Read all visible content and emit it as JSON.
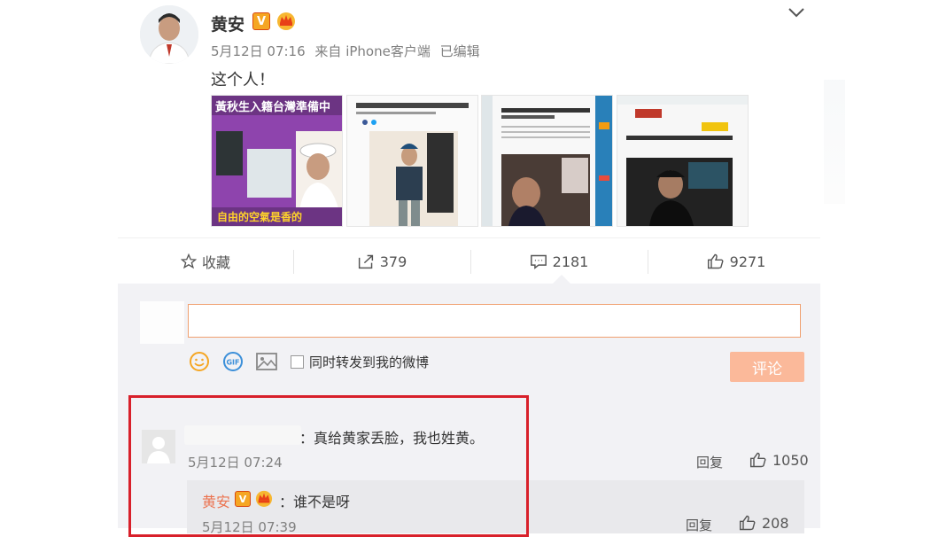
{
  "post": {
    "username": "黄安",
    "verified_badge": "V",
    "time": "5月12日 07:16",
    "source": "来自 iPhone客户端",
    "edited": "已编辑",
    "text": "这个人！",
    "images": [
      {
        "name": "post-image-1",
        "caption_top": "黃秋生入籍台灣準備中",
        "caption_bottom": "自由的空氣是香的"
      },
      {
        "name": "post-image-2"
      },
      {
        "name": "post-image-3"
      },
      {
        "name": "post-image-4"
      }
    ]
  },
  "actions": {
    "favorite_label": "收藏",
    "repost_count": "379",
    "comment_count": "2181",
    "like_count": "9271"
  },
  "composer": {
    "input_value": "",
    "repost_checkbox_label": "同时转发到我的微博",
    "submit_label": "评论"
  },
  "comments": [
    {
      "text": "：真给黄家丢脸，我也姓黄。",
      "time": "5月12日 07:24",
      "reply_label": "回复",
      "likes": "1050",
      "replies": [
        {
          "username": "黄安",
          "verified_badge": "V",
          "text": "：谁不是呀",
          "time": "5月12日 07:39",
          "reply_label": "回复",
          "likes": "208"
        }
      ]
    }
  ],
  "colors": {
    "accent_orange": "#eb7350",
    "submit_disabled": "#fbb99a",
    "highlight_red": "#d8202a",
    "comment_bg": "#f2f2f5"
  }
}
